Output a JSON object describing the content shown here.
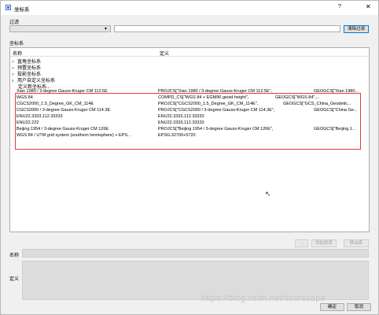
{
  "window": {
    "title": "坐标系",
    "help": "?",
    "close": "✕"
  },
  "filter": {
    "label": "过滤",
    "combo_value": "",
    "input_value": "",
    "clear_button": "清除过滤"
  },
  "coord_section": {
    "label": "坐标系"
  },
  "tree": {
    "headers": {
      "name": "名称",
      "definition": "定义"
    },
    "folders": [
      {
        "label": "直角坐标系",
        "expanded": false
      },
      {
        "label": "预置坐标系",
        "expanded": false
      },
      {
        "label": "投影坐标系",
        "expanded": false
      },
      {
        "label": "用户自定义坐标系",
        "expanded": true
      }
    ],
    "custom_header": "定义新坐标系...",
    "rows": [
      {
        "name": "Xian 1980 / 3-degree Gauss-Kruger CM 112.5E",
        "def1": "PROJCS[\"Xian 1980 / 3-degree Gauss-Kruger CM 112.5E\",",
        "def2": "GEOGCS[\"Xian 1980..."
      },
      {
        "name": "WGS 84",
        "def1": "COMPD_CS[\"WGS 84 + EGM96 geoid height\",",
        "def2": "GEOGCS[\"WGS 84\",..."
      },
      {
        "name": "CGCS2000_1.5_Degree_GK_CM_114E",
        "def1": "PROJCS[\"CGCS2000_1.5_Degree_GK_CM_114E\",",
        "def2": "GEOGCS[\"GCS_China_Geodetic..."
      },
      {
        "name": "CGCS2000 / 3-degree Gauss-Kruger CM 114.3E",
        "def1": "PROJCS[\"CGCS2000 / 3-degree Gauss-Kruger CM 114.3E\",",
        "def2": "GEOGCS[\"China Ge..."
      },
      {
        "name": "ENU22.3333,112.33333",
        "def1": "ENU22.3333,112.33333",
        "def2": ""
      },
      {
        "name": "ENU22.222",
        "def1": "ENU22.3333,112.33333",
        "def2": ""
      },
      {
        "name": "Beijing 1954 / 3-degree Gauss-Kruger CM 126E",
        "def1": "PROJCS[\"Beijing 1954 / 3-degree Gauss-Kruger CM 126E\",",
        "def2": "GEOGCS[\"Beijing 1..."
      },
      {
        "name": "WGS 84 / UTM grid system (southern hemisphere) + EPS...",
        "def1": "EPSG:32700+5720",
        "def2": ""
      }
    ]
  },
  "actions": {
    "more": "...",
    "add": "添加到库",
    "remove": "移出库"
  },
  "fields": {
    "name_label": "名称",
    "definition_label": "定义"
  },
  "footer": {
    "ok": "确定",
    "cancel": "取消"
  },
  "watermark": "https://blog.csdn.net/scarscape"
}
